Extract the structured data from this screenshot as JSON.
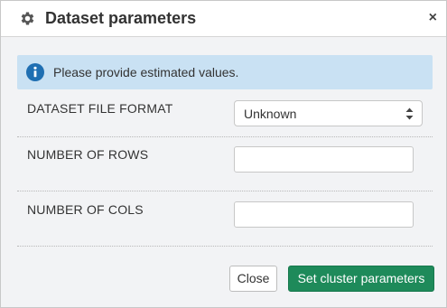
{
  "dialog": {
    "title": "Dataset parameters",
    "close_glyph": "×",
    "header_icon": "gear-icon"
  },
  "alert": {
    "icon": "info-circle-icon",
    "message": "Please provide estimated values.",
    "background": "#c9e1f3",
    "icon_color": "#1f6fb2"
  },
  "fields": {
    "format": {
      "label": "DATASET FILE FORMAT",
      "selected": "Unknown"
    },
    "rows": {
      "label": "NUMBER OF ROWS",
      "value": ""
    },
    "cols": {
      "label": "NUMBER OF COLS",
      "value": ""
    }
  },
  "buttons": {
    "close": "Close",
    "submit": "Set cluster parameters",
    "submit_color": "#1e8a5a"
  }
}
